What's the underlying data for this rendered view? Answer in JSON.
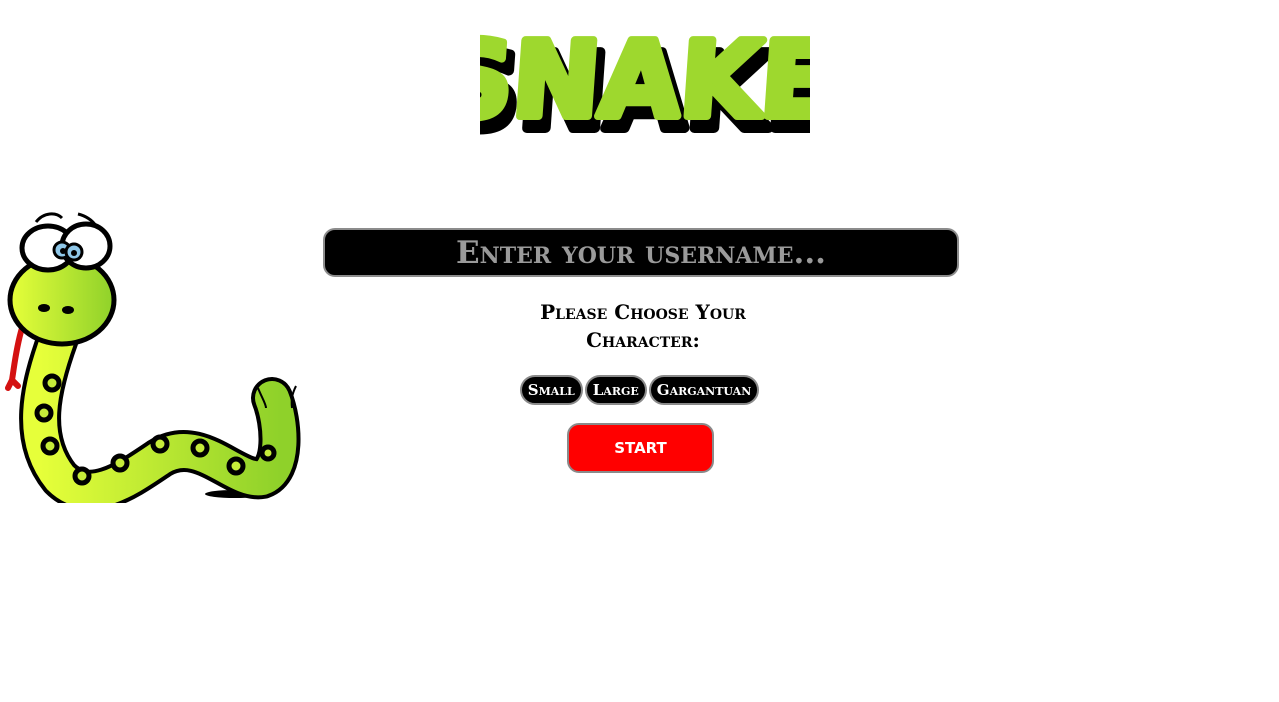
{
  "header": {
    "logo_text": "SNAKE",
    "logo_color": "#9ed82e",
    "logo_shadow_color": "#000000"
  },
  "illustration": {
    "icon": "cartoon-snake-icon",
    "body_color": "#c6ec3a"
  },
  "form": {
    "username_placeholder": "Enter your username...",
    "username_value": "",
    "character_prompt_line1": "Please Choose Your",
    "character_prompt_line2": "Character:",
    "character_options": [
      {
        "label": "Small"
      },
      {
        "label": "Large"
      },
      {
        "label": "Gargantuan"
      }
    ],
    "start_label": "START",
    "start_color": "#ff0000"
  }
}
